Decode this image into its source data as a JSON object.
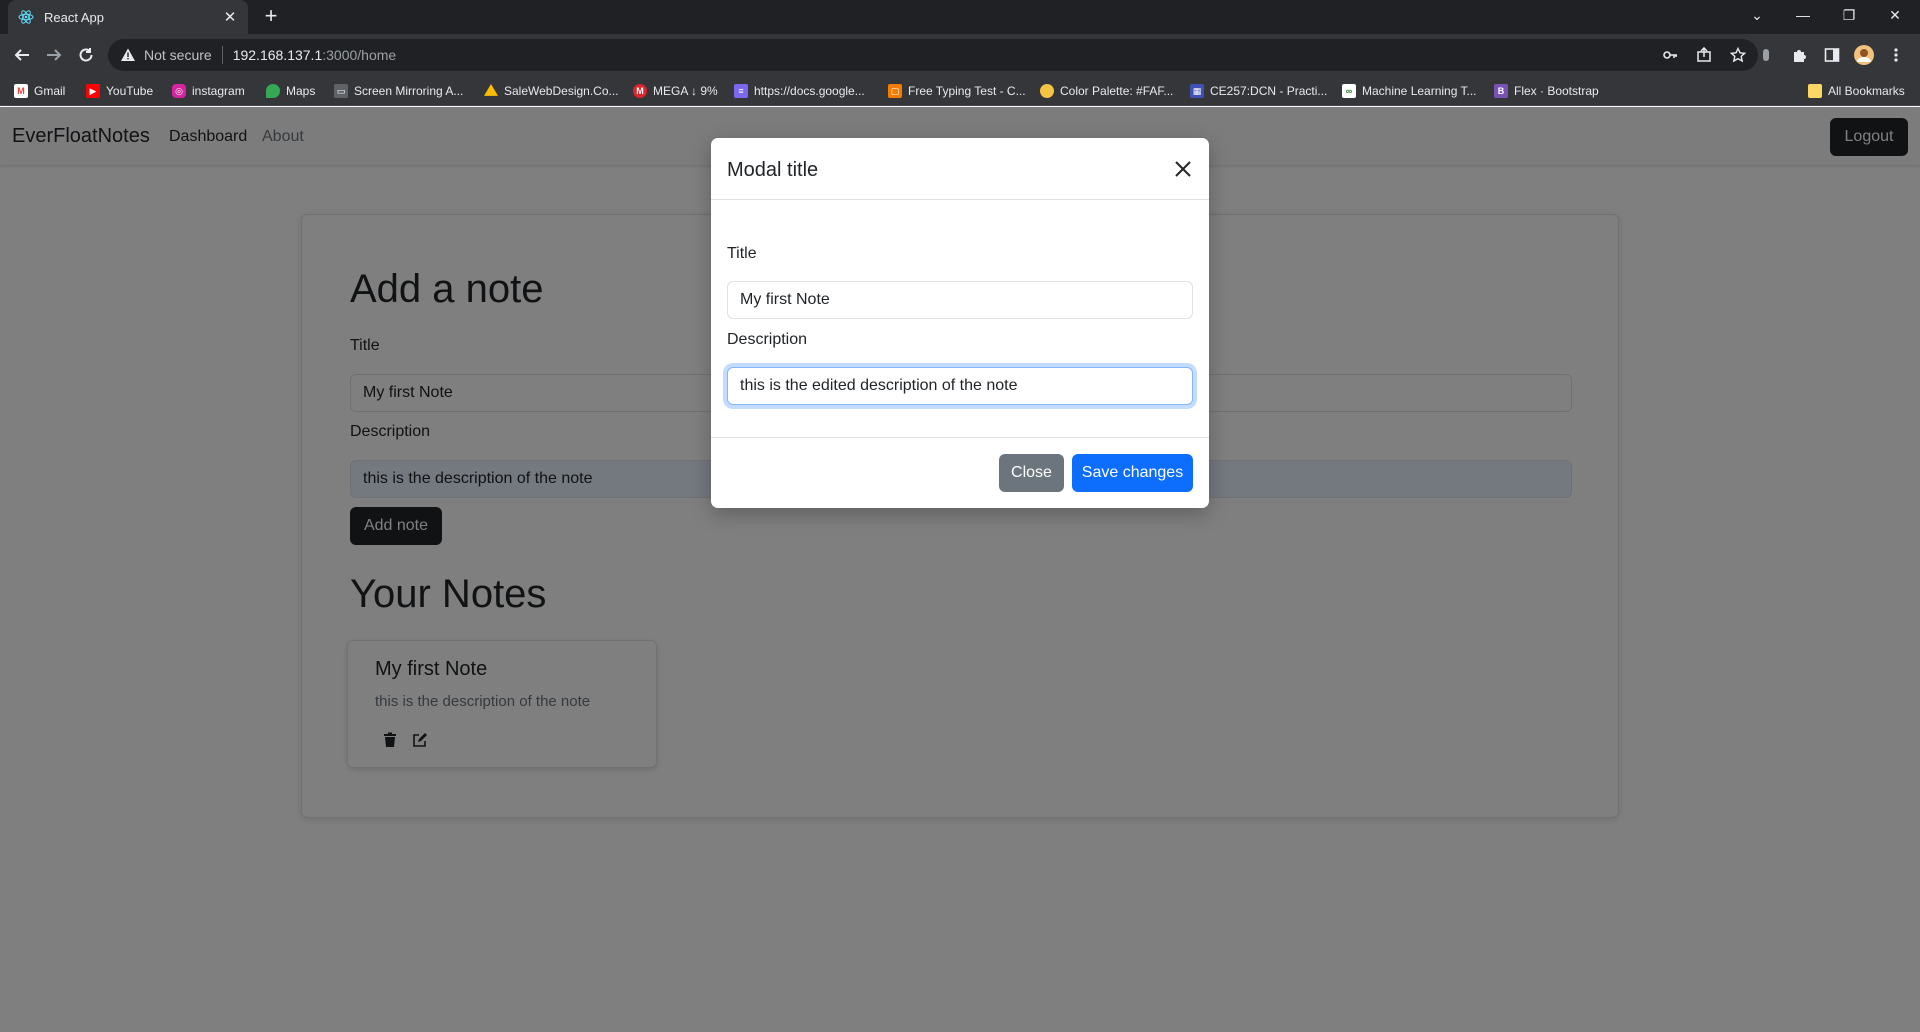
{
  "browser": {
    "tab_title": "React App",
    "omnibox": {
      "security_label": "Not secure",
      "host": "192.168.137.1",
      "path": ":3000/home"
    },
    "bookmarks": [
      {
        "label": "Gmail",
        "icon": "gmail-icon",
        "color": "#ea4335"
      },
      {
        "label": "YouTube",
        "icon": "youtube-icon",
        "color": "#ff0000"
      },
      {
        "label": "instagram",
        "icon": "instagram-icon",
        "color": "#d6249f"
      },
      {
        "label": "Maps",
        "icon": "maps-icon",
        "color": "#34a853"
      },
      {
        "label": "Screen Mirroring A...",
        "icon": "screen-mirroring-icon",
        "color": "#e8eaed"
      },
      {
        "label": "SaleWebDesign.Co...",
        "icon": "drive-icon",
        "color": "#fbbc04"
      },
      {
        "label": "MEGA ↓ 9%",
        "icon": "mega-icon",
        "color": "#d9272e"
      },
      {
        "label": "https://docs.google...",
        "icon": "docs-icon",
        "color": "#7b68ee"
      },
      {
        "label": "Free Typing Test - C...",
        "icon": "typing-icon",
        "color": "#f57c00"
      },
      {
        "label": "Color Palette: #FAF...",
        "icon": "palette-icon",
        "color": "#f4c542"
      },
      {
        "label": "CE257:DCN - Practi...",
        "icon": "classroom-icon",
        "color": "#3f51b5"
      },
      {
        "label": "Machine Learning T...",
        "icon": "ml-icon",
        "color": "#2e7d32"
      },
      {
        "label": "Flex · Bootstrap",
        "icon": "bootstrap-icon",
        "color": "#7952b3"
      }
    ],
    "all_bookmarks_label": "All Bookmarks"
  },
  "app": {
    "brand": "EverFloatNotes",
    "nav": [
      {
        "label": "Dashboard"
      },
      {
        "label": "About"
      }
    ],
    "logout_label": "Logout",
    "add_note": {
      "heading": "Add a note",
      "title_label": "Title",
      "title_value": "My first Note",
      "description_label": "Description",
      "description_value": "this is the description of the note",
      "button_label": "Add note"
    },
    "notes_heading": "Your Notes",
    "notes": [
      {
        "title": "My first Note",
        "description": "this is the description of the note"
      }
    ]
  },
  "modal": {
    "title": "Modal title",
    "title_label": "Title",
    "title_value": "My first Note",
    "description_label": "Description",
    "description_value": "this is the edited description of the note",
    "close_label": "Close",
    "save_label": "Save changes"
  },
  "colors": {
    "primary": "#0d6efd",
    "secondary": "#6c757d",
    "dark": "#212529"
  }
}
